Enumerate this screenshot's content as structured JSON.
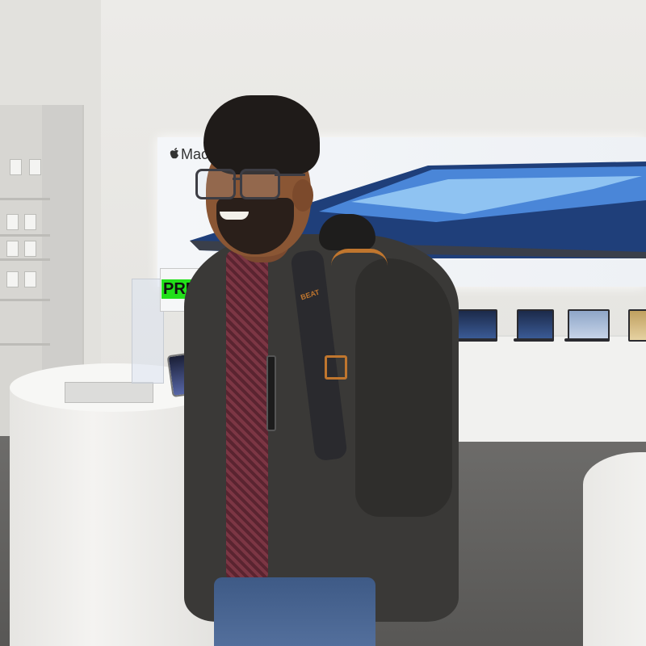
{
  "scene": {
    "description_label": "photo"
  },
  "display_banner": {
    "brand_text": "Mac"
  },
  "counter_sign": {
    "text": "PRES"
  },
  "backpack": {
    "brand_text": "BEAT"
  },
  "colors": {
    "sign_green": "#22e01a",
    "strap_orange": "#c0762e",
    "jacket": "#3a3937",
    "banner_laptop_blue": "#3c5d9a"
  }
}
